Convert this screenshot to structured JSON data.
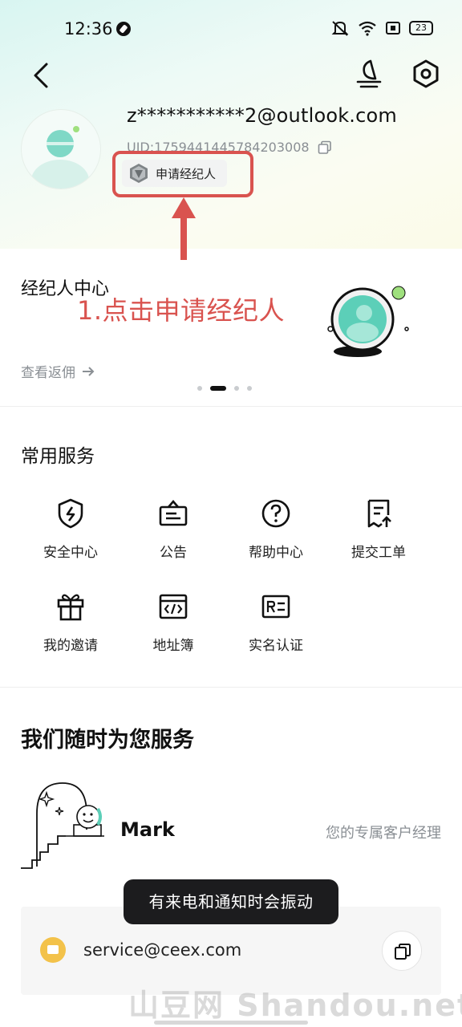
{
  "status_bar": {
    "time": "12:36",
    "battery": "23"
  },
  "profile": {
    "email": "z***********2@outlook.com",
    "uid": "UID:1759441445784203008",
    "broker_button_label": "申请经纪人"
  },
  "annotation": {
    "text": "1.点击申请经纪人",
    "color": "#d9534f"
  },
  "broker_card": {
    "title": "经纪人中心",
    "link_label": "查看返佣",
    "pages": 4,
    "active_page": 2
  },
  "services": {
    "title": "常用服务",
    "items": [
      {
        "label": "安全中心",
        "icon": "shield-icon"
      },
      {
        "label": "公告",
        "icon": "announcement-icon"
      },
      {
        "label": "帮助中心",
        "icon": "help-icon"
      },
      {
        "label": "提交工单",
        "icon": "ticket-icon"
      },
      {
        "label": "我的邀请",
        "icon": "gift-icon"
      },
      {
        "label": "地址簿",
        "icon": "address-book-icon"
      },
      {
        "label": "实名认证",
        "icon": "id-card-icon"
      }
    ]
  },
  "support": {
    "title": "我们随时为您服务",
    "manager_name": "Mark",
    "manager_role": "您的专属客户经理",
    "email": "service@ceex.com"
  },
  "toast": {
    "text": "有来电和通知时会振动"
  },
  "watermark": {
    "text": "山豆网 Shandou.net"
  },
  "colors": {
    "accent_teal": "#5ccfb8",
    "highlight_red": "#d9534f",
    "mail_yellow": "#f3c24a"
  }
}
